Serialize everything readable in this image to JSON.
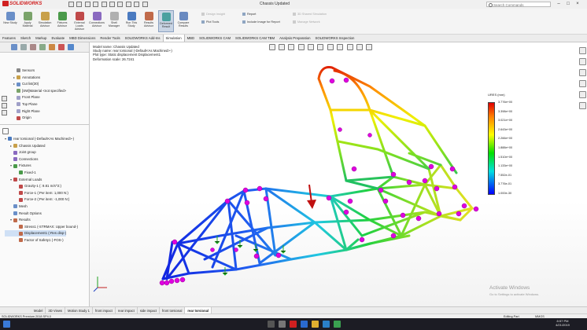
{
  "app": {
    "brand": "SOLIDWORKS",
    "document_title": "Chassis Updated",
    "search_placeholder": "Search Commands",
    "window_controls": [
      "–",
      "□",
      "×"
    ]
  },
  "command_manager": {
    "buttons": [
      {
        "label": "New Study",
        "icon": "new-study-icon",
        "color": "#6a8fc8"
      },
      {
        "label": "Apply Material",
        "icon": "apply-material-icon",
        "color": "#7aa36a"
      },
      {
        "label": "Simulation Advisor",
        "icon": "advisor-icon",
        "color": "#c8a04a"
      },
      {
        "label": "Fixtures Advisor",
        "icon": "fixtures-icon",
        "color": "#4a9a4a"
      },
      {
        "label": "External Loads Advisor",
        "icon": "external-loads-icon",
        "color": "#c04a4a"
      },
      {
        "label": "Connections Advisor",
        "icon": "connections-icon",
        "color": "#8a6ac0"
      },
      {
        "label": "Shell Manager",
        "icon": "shell-manager-icon",
        "color": "#b0b0b0"
      },
      {
        "label": "Run This Study",
        "icon": "run-study-icon",
        "color": "#4a7ac0"
      },
      {
        "label": "Results Advisor",
        "icon": "results-advisor-icon",
        "color": "#c06a4a"
      },
      {
        "label": "Deformed Result",
        "icon": "deformed-result-icon",
        "color": "#4aa0a0"
      },
      {
        "label": "Compare Results",
        "icon": "compare-results-icon",
        "color": "#6a8ac0"
      }
    ],
    "small_items": [
      {
        "label": "Design Insight",
        "enabled": false
      },
      {
        "label": "Plot Tools",
        "enabled": true
      },
      {
        "label": "Report",
        "enabled": true
      },
      {
        "label": "Include Image for Report",
        "enabled": true
      },
      {
        "label": "3D Shared Simulation",
        "enabled": false
      },
      {
        "label": "Manage Network",
        "enabled": false
      }
    ]
  },
  "tabs": [
    "Features",
    "Sketch",
    "Markup",
    "Evaluate",
    "MBD Dimensions",
    "Render Tools",
    "SOLIDWORKS Add-Ins",
    "Simulation",
    "MBD",
    "SOLIDWORKS CAM",
    "SOLIDWORKS CAM TBM",
    "Analysis Preparation",
    "SOLIDWORKS Inspection"
  ],
  "active_tab": "Simulation",
  "feature_tree": [
    {
      "label": "Sensors",
      "indent": 1,
      "expander": "",
      "color": "#888"
    },
    {
      "label": "Annotations",
      "indent": 1,
      "expander": "▸",
      "color": "#c8a04a"
    },
    {
      "label": "Cut list(30)",
      "indent": 1,
      "expander": "▸",
      "color": "#6a8fc8"
    },
    {
      "label": "[SW]Material <not specified>",
      "indent": 1,
      "expander": "",
      "color": "#7aa36a"
    },
    {
      "label": "Front Plane",
      "indent": 1,
      "expander": "",
      "color": "#a0a0c8"
    },
    {
      "label": "Top Plane",
      "indent": 1,
      "expander": "",
      "color": "#a0a0c8"
    },
    {
      "label": "Right Plane",
      "indent": 1,
      "expander": "",
      "color": "#a0a0c8"
    },
    {
      "label": "Origin",
      "indent": 1,
      "expander": "",
      "color": "#c04a4a"
    }
  ],
  "study_tree": [
    {
      "label": "rear torsional (-Default<As Machined>-)",
      "indent": 0,
      "expander": "▾",
      "color": "#4a7ac0",
      "selected": false
    },
    {
      "label": "Chassis Updated",
      "indent": 1,
      "expander": "▸",
      "color": "#c8a04a",
      "selected": false
    },
    {
      "label": "Joint group",
      "indent": 1,
      "expander": "",
      "color": "#8a6ac0",
      "selected": false
    },
    {
      "label": "Connections",
      "indent": 1,
      "expander": "",
      "color": "#8a6ac0",
      "selected": false
    },
    {
      "label": "Fixtures",
      "indent": 1,
      "expander": "▾",
      "color": "#4a9a4a",
      "selected": false
    },
    {
      "label": "Fixed-1",
      "indent": 2,
      "expander": "",
      "color": "#4a9a4a",
      "selected": false
    },
    {
      "label": "External Loads",
      "indent": 1,
      "expander": "▾",
      "color": "#c04a4a",
      "selected": false
    },
    {
      "label": "Gravity-1 (: 9.81 m/s^2:)",
      "indent": 2,
      "expander": "",
      "color": "#c04a4a",
      "selected": false
    },
    {
      "label": "Force-1 (:Per item: 1,000 N:)",
      "indent": 2,
      "expander": "",
      "color": "#c04a4a",
      "selected": false
    },
    {
      "label": "Force-2 (:Per item: -1,000 N:)",
      "indent": 2,
      "expander": "",
      "color": "#c04a4a",
      "selected": false
    },
    {
      "label": "Mesh",
      "indent": 1,
      "expander": "",
      "color": "#6a8fc8",
      "selected": false
    },
    {
      "label": "Result Options",
      "indent": 1,
      "expander": "",
      "color": "#6a8fc8",
      "selected": false
    },
    {
      "label": "Results",
      "indent": 1,
      "expander": "▾",
      "color": "#c06a4a",
      "selected": false
    },
    {
      "label": "Stress1 (-STRMAX: Upper bound-)",
      "indent": 2,
      "expander": "",
      "color": "#c06a4a",
      "selected": false
    },
    {
      "label": "Displacement1 (-Res disp-)",
      "indent": 2,
      "expander": "",
      "color": "#c06a4a",
      "selected": true
    },
    {
      "label": "Factor of Safety1 (-FOS-)",
      "indent": 2,
      "expander": "",
      "color": "#c06a4a",
      "selected": false
    }
  ],
  "viewport": {
    "info_lines": [
      "Model name: Chassis Updated",
      "Study name: rear torsional (-Default<As Machined>-)",
      "Plot type: Static displacement Displacement1",
      "Deformation scale: 26.7241"
    ],
    "legend": {
      "title": "URES (mm)",
      "labels": [
        "3.776e+00",
        "3.398e+00",
        "3.021e+00",
        "2.643e+00",
        "2.266e+00",
        "1.888e+00",
        "1.510e+00",
        "1.133e+00",
        "7.552e-01",
        "3.776e-01",
        "1.000e-30"
      ]
    },
    "watermark": {
      "title": "Activate Windows",
      "sub": "Go to Settings to activate Windows."
    }
  },
  "bottom_tabs": [
    "Model",
    "3D Views",
    "Motion Study 1",
    "front impact",
    "rear impact",
    "side impact",
    "front torsional",
    "rear torsional"
  ],
  "active_bottom_tab": "rear torsional",
  "status": {
    "left": "SOLIDWORKS Premium 2018 SP4.0",
    "middle": "Editing Part",
    "units": "MMGS"
  },
  "taskbar": {
    "time": "8:57 PM",
    "date": "4/21/2019"
  }
}
